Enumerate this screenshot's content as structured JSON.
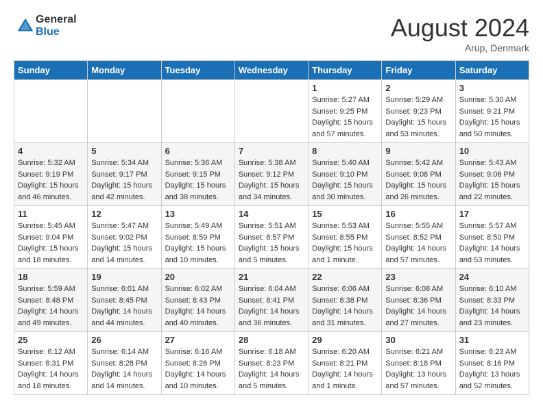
{
  "header": {
    "logo_general": "General",
    "logo_blue": "Blue",
    "month_year": "August 2024",
    "location": "Arup, Denmark"
  },
  "days_of_week": [
    "Sunday",
    "Monday",
    "Tuesday",
    "Wednesday",
    "Thursday",
    "Friday",
    "Saturday"
  ],
  "weeks": [
    [
      {
        "day": "",
        "info": ""
      },
      {
        "day": "",
        "info": ""
      },
      {
        "day": "",
        "info": ""
      },
      {
        "day": "",
        "info": ""
      },
      {
        "day": "1",
        "info": "Sunrise: 5:27 AM\nSunset: 9:25 PM\nDaylight: 15 hours\nand 57 minutes."
      },
      {
        "day": "2",
        "info": "Sunrise: 5:29 AM\nSunset: 9:23 PM\nDaylight: 15 hours\nand 53 minutes."
      },
      {
        "day": "3",
        "info": "Sunrise: 5:30 AM\nSunset: 9:21 PM\nDaylight: 15 hours\nand 50 minutes."
      }
    ],
    [
      {
        "day": "4",
        "info": "Sunrise: 5:32 AM\nSunset: 9:19 PM\nDaylight: 15 hours\nand 46 minutes."
      },
      {
        "day": "5",
        "info": "Sunrise: 5:34 AM\nSunset: 9:17 PM\nDaylight: 15 hours\nand 42 minutes."
      },
      {
        "day": "6",
        "info": "Sunrise: 5:36 AM\nSunset: 9:15 PM\nDaylight: 15 hours\nand 38 minutes."
      },
      {
        "day": "7",
        "info": "Sunrise: 5:38 AM\nSunset: 9:12 PM\nDaylight: 15 hours\nand 34 minutes."
      },
      {
        "day": "8",
        "info": "Sunrise: 5:40 AM\nSunset: 9:10 PM\nDaylight: 15 hours\nand 30 minutes."
      },
      {
        "day": "9",
        "info": "Sunrise: 5:42 AM\nSunset: 9:08 PM\nDaylight: 15 hours\nand 26 minutes."
      },
      {
        "day": "10",
        "info": "Sunrise: 5:43 AM\nSunset: 9:06 PM\nDaylight: 15 hours\nand 22 minutes."
      }
    ],
    [
      {
        "day": "11",
        "info": "Sunrise: 5:45 AM\nSunset: 9:04 PM\nDaylight: 15 hours\nand 18 minutes."
      },
      {
        "day": "12",
        "info": "Sunrise: 5:47 AM\nSunset: 9:02 PM\nDaylight: 15 hours\nand 14 minutes."
      },
      {
        "day": "13",
        "info": "Sunrise: 5:49 AM\nSunset: 8:59 PM\nDaylight: 15 hours\nand 10 minutes."
      },
      {
        "day": "14",
        "info": "Sunrise: 5:51 AM\nSunset: 8:57 PM\nDaylight: 15 hours\nand 5 minutes."
      },
      {
        "day": "15",
        "info": "Sunrise: 5:53 AM\nSunset: 8:55 PM\nDaylight: 15 hours\nand 1 minute."
      },
      {
        "day": "16",
        "info": "Sunrise: 5:55 AM\nSunset: 8:52 PM\nDaylight: 14 hours\nand 57 minutes."
      },
      {
        "day": "17",
        "info": "Sunrise: 5:57 AM\nSunset: 8:50 PM\nDaylight: 14 hours\nand 53 minutes."
      }
    ],
    [
      {
        "day": "18",
        "info": "Sunrise: 5:59 AM\nSunset: 8:48 PM\nDaylight: 14 hours\nand 49 minutes."
      },
      {
        "day": "19",
        "info": "Sunrise: 6:01 AM\nSunset: 8:45 PM\nDaylight: 14 hours\nand 44 minutes."
      },
      {
        "day": "20",
        "info": "Sunrise: 6:02 AM\nSunset: 8:43 PM\nDaylight: 14 hours\nand 40 minutes."
      },
      {
        "day": "21",
        "info": "Sunrise: 6:04 AM\nSunset: 8:41 PM\nDaylight: 14 hours\nand 36 minutes."
      },
      {
        "day": "22",
        "info": "Sunrise: 6:06 AM\nSunset: 8:38 PM\nDaylight: 14 hours\nand 31 minutes."
      },
      {
        "day": "23",
        "info": "Sunrise: 6:08 AM\nSunset: 8:36 PM\nDaylight: 14 hours\nand 27 minutes."
      },
      {
        "day": "24",
        "info": "Sunrise: 6:10 AM\nSunset: 8:33 PM\nDaylight: 14 hours\nand 23 minutes."
      }
    ],
    [
      {
        "day": "25",
        "info": "Sunrise: 6:12 AM\nSunset: 8:31 PM\nDaylight: 14 hours\nand 18 minutes."
      },
      {
        "day": "26",
        "info": "Sunrise: 6:14 AM\nSunset: 8:28 PM\nDaylight: 14 hours\nand 14 minutes."
      },
      {
        "day": "27",
        "info": "Sunrise: 6:16 AM\nSunset: 8:26 PM\nDaylight: 14 hours\nand 10 minutes."
      },
      {
        "day": "28",
        "info": "Sunrise: 6:18 AM\nSunset: 8:23 PM\nDaylight: 14 hours\nand 5 minutes."
      },
      {
        "day": "29",
        "info": "Sunrise: 6:20 AM\nSunset: 8:21 PM\nDaylight: 14 hours\nand 1 minute."
      },
      {
        "day": "30",
        "info": "Sunrise: 6:21 AM\nSunset: 8:18 PM\nDaylight: 13 hours\nand 57 minutes."
      },
      {
        "day": "31",
        "info": "Sunrise: 6:23 AM\nSunset: 8:16 PM\nDaylight: 13 hours\nand 52 minutes."
      }
    ]
  ]
}
